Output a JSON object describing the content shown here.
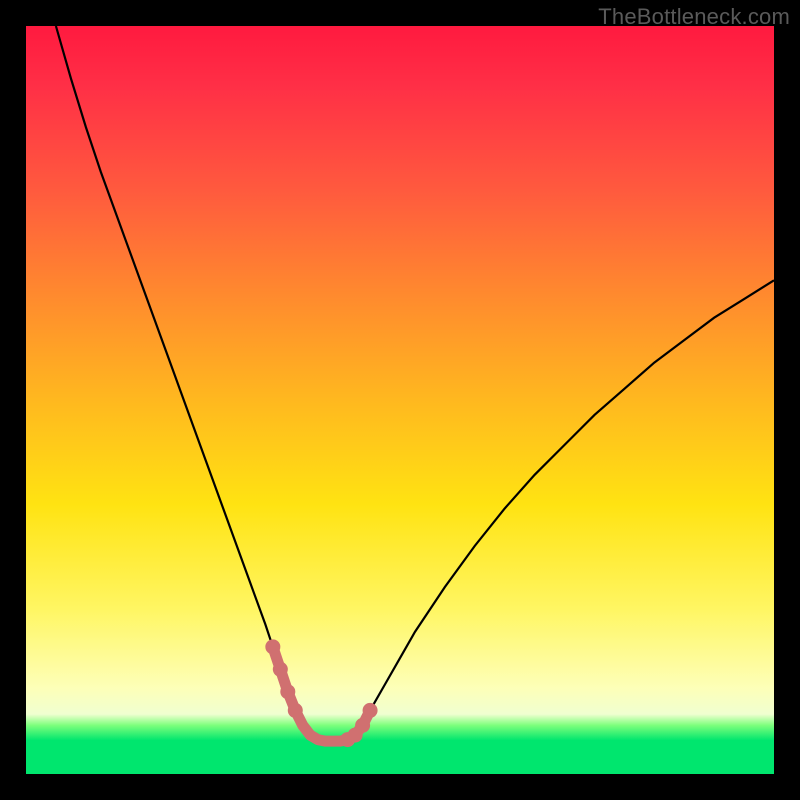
{
  "watermark": {
    "text": "TheBottleneck.com"
  },
  "colors": {
    "frame_bg": "#000000",
    "curve_stroke": "#000000",
    "highlight_stroke": "#d07070",
    "highlight_dot_fill": "#d07070"
  },
  "chart_data": {
    "type": "line",
    "title": "",
    "xlabel": "",
    "ylabel": "",
    "xlim": [
      0,
      100
    ],
    "ylim": [
      0,
      100
    ],
    "grid": false,
    "legend": false,
    "series": [
      {
        "name": "curve",
        "x": [
          4,
          6,
          8,
          10,
          12,
          14,
          16,
          18,
          20,
          22,
          24,
          26,
          28,
          30,
          32,
          33,
          34,
          35,
          36,
          37,
          38,
          39,
          40,
          41,
          42,
          43,
          44,
          45,
          46,
          48,
          50,
          52,
          56,
          60,
          64,
          68,
          72,
          76,
          80,
          84,
          88,
          92,
          96,
          100
        ],
        "y": [
          100,
          93,
          86.5,
          80.5,
          75,
          69.5,
          64,
          58.5,
          53,
          47.5,
          42,
          36.5,
          31,
          25.5,
          20,
          17,
          14,
          11,
          8.5,
          6.5,
          5.2,
          4.6,
          4.4,
          4.4,
          4.4,
          4.6,
          5.2,
          6.5,
          8.5,
          12,
          15.5,
          19,
          25,
          30.5,
          35.5,
          40,
          44,
          48,
          51.5,
          55,
          58,
          61,
          63.5,
          66
        ]
      }
    ],
    "highlight": {
      "x": [
        33,
        34,
        35,
        36,
        37,
        38,
        39,
        40,
        41,
        42,
        43,
        44,
        45,
        46
      ],
      "y": [
        17,
        14,
        11,
        8.5,
        6.5,
        5.2,
        4.6,
        4.4,
        4.4,
        4.4,
        4.6,
        5.2,
        6.5,
        8.5
      ],
      "dot_indices": [
        0,
        1,
        2,
        3,
        10,
        11,
        12,
        13
      ]
    }
  }
}
